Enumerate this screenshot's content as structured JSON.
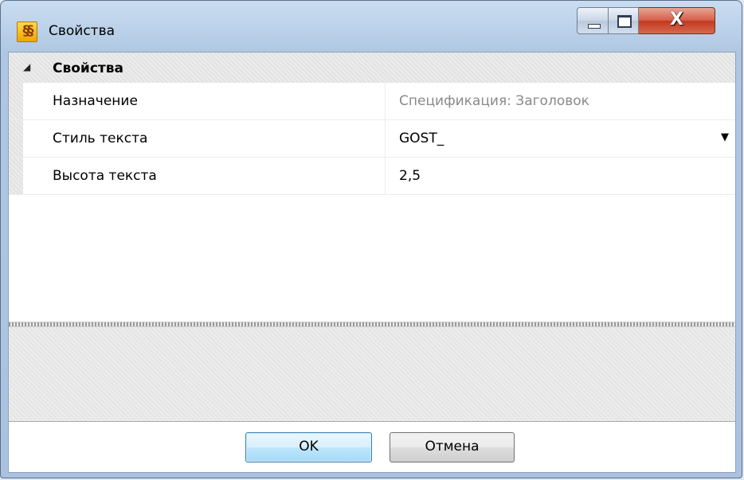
{
  "window": {
    "title": "Свойства",
    "app_icon_glyph": "§§",
    "close_glyph": "X"
  },
  "property_grid": {
    "category": {
      "label": "Свойства",
      "expand_glyph": "◢",
      "expanded": true
    },
    "rows": [
      {
        "name": "Назначение",
        "value": "Спецификация: Заголовок",
        "readonly": true
      },
      {
        "name": "Стиль текста",
        "value": "GOST_",
        "dropdown_glyph": "▼"
      },
      {
        "name": "Высота текста",
        "value": "2,5"
      }
    ]
  },
  "buttons": {
    "ok": "OK",
    "cancel": "Отмена"
  },
  "colors": {
    "accent": "#3c7fb1",
    "close_button": "#c2391f",
    "readonly_text": "#8a8a8a"
  }
}
